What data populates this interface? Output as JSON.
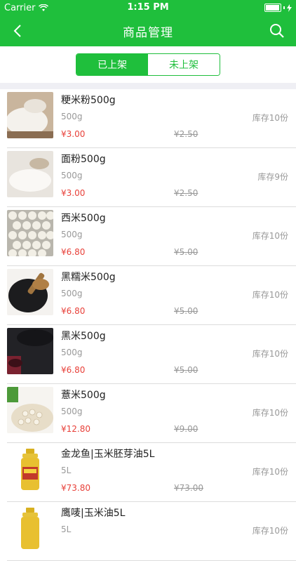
{
  "status": {
    "carrier": "Carrier",
    "time": "1:15 PM"
  },
  "nav": {
    "title": "商品管理"
  },
  "tabs": [
    {
      "label": "已上架"
    },
    {
      "label": "未上架"
    }
  ],
  "products": [
    {
      "name": "粳米粉500g",
      "spec": "500g",
      "stock": "库存10份",
      "price": "¥3.00",
      "original_price": "¥2.50",
      "image": "rice-flour"
    },
    {
      "name": "面粉500g",
      "spec": "500g",
      "stock": "库存9份",
      "price": "¥3.00",
      "original_price": "¥2.50",
      "image": "wheat-flour"
    },
    {
      "name": "西米500g",
      "spec": "500g",
      "stock": "库存10份",
      "price": "¥6.80",
      "original_price": "¥5.00",
      "image": "sago"
    },
    {
      "name": "黑糯米500g",
      "spec": "500g",
      "stock": "库存10份",
      "price": "¥6.80",
      "original_price": "¥5.00",
      "image": "black-glutinous-rice"
    },
    {
      "name": "黑米500g",
      "spec": "500g",
      "stock": "库存10份",
      "price": "¥6.80",
      "original_price": "¥5.00",
      "image": "black-rice"
    },
    {
      "name": "薏米500g",
      "spec": "500g",
      "stock": "库存10份",
      "price": "¥12.80",
      "original_price": "¥9.00",
      "image": "barley"
    },
    {
      "name": "金龙鱼|玉米胚芽油5L",
      "spec": "5L",
      "stock": "库存10份",
      "price": "¥73.80",
      "original_price": "¥73.00",
      "image": "corn-oil-bottle"
    },
    {
      "name": "鹰唛|玉米油5L",
      "spec": "5L",
      "stock": "库存10份",
      "price": "",
      "original_price": "",
      "image": "corn-oil-bottle"
    }
  ]
}
